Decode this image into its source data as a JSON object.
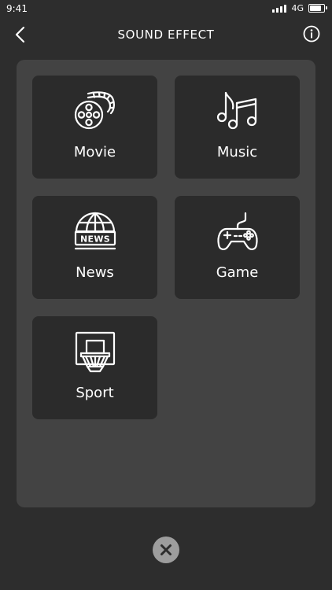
{
  "status_bar": {
    "time": "9:41",
    "network": "4G",
    "signal_bars": 4,
    "battery_level": 0.9
  },
  "header": {
    "title": "SOUND EFFECT",
    "back_icon": "chevron-left-icon",
    "info_icon": "info-circle-icon"
  },
  "effects": [
    {
      "label": "Movie",
      "icon": "film-reel-icon"
    },
    {
      "label": "Music",
      "icon": "music-notes-icon"
    },
    {
      "label": "News",
      "icon": "news-globe-icon"
    },
    {
      "label": "Game",
      "icon": "gamepad-icon"
    },
    {
      "label": "Sport",
      "icon": "basketball-hoop-icon"
    }
  ],
  "footer": {
    "close_icon": "close-icon"
  },
  "colors": {
    "background": "#2d2d2d",
    "panel": "#434343",
    "tile": "#2b2b2b",
    "close_button": "#9d9d9d",
    "text": "#ffffff"
  }
}
